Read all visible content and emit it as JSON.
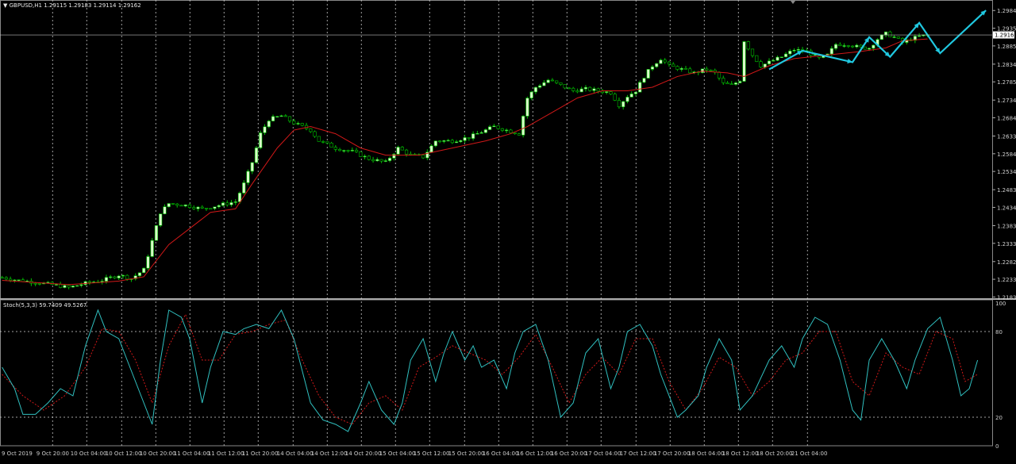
{
  "header": {
    "symbol": "GBPUSD,H1",
    "ohlc": "1.29115 1.29183 1.29114 1.29162"
  },
  "current_price": "1.29162",
  "stoch_header": "Stoch(5,3,3) 59.7409 49.5267",
  "price_axis_labels": [
    "1.29845",
    "1.29350",
    "1.28855",
    "1.28345",
    "1.27850",
    "1.27340",
    "1.26845",
    "1.26335",
    "1.25840",
    "1.25345",
    "1.24835",
    "1.24340",
    "1.23830",
    "1.23335",
    "1.22825",
    "1.22330",
    "1.21835"
  ],
  "stoch_axis_labels": [
    "100",
    "80",
    "20",
    "0"
  ],
  "time_labels": [
    "9 Oct 2019",
    "9 Oct 20:00",
    "10 Oct 04:00",
    "10 Oct 12:00",
    "10 Oct 20:00",
    "11 Oct 04:00",
    "11 Oct 12:00",
    "11 Oct 20:00",
    "14 Oct 04:00",
    "14 Oct 12:00",
    "14 Oct 20:00",
    "15 Oct 04:00",
    "15 Oct 12:00",
    "15 Oct 20:00",
    "16 Oct 04:00",
    "16 Oct 12:00",
    "16 Oct 20:00",
    "17 Oct 04:00",
    "17 Oct 12:00",
    "17 Oct 20:00",
    "18 Oct 04:00",
    "18 Oct 12:00",
    "18 Oct 20:00",
    "21 Oct 04:00"
  ],
  "colors": {
    "background": "#000000",
    "bull_candle": "#d8ffc8",
    "bear_candle": "#000000",
    "wick": "#00c000",
    "ma_line": "#d01818",
    "stoch_main": "#30c0c0",
    "stoch_signal": "#d01818",
    "arrows": "#20c8e0",
    "grid": "#c8c8c8"
  },
  "chart_data": [
    {
      "type": "candlestick",
      "title": "GBPUSD,H1",
      "ylim": [
        1.218,
        1.3005
      ],
      "grid": true,
      "close_path": [
        [
          0,
          1.2238
        ],
        [
          4,
          1.223
        ],
        [
          8,
          1.2225
        ],
        [
          12,
          1.2218
        ],
        [
          16,
          1.221
        ],
        [
          20,
          1.2222
        ],
        [
          24,
          1.223
        ],
        [
          28,
          1.2245
        ],
        [
          31,
          1.2235
        ],
        [
          34,
          1.226
        ],
        [
          36,
          1.234
        ],
        [
          38,
          1.242
        ],
        [
          40,
          1.2445
        ],
        [
          44,
          1.244
        ],
        [
          48,
          1.243
        ],
        [
          52,
          1.244
        ],
        [
          56,
          1.245
        ],
        [
          58,
          1.25
        ],
        [
          60,
          1.256
        ],
        [
          62,
          1.264
        ],
        [
          64,
          1.268
        ],
        [
          67,
          1.269
        ],
        [
          70,
          1.267
        ],
        [
          74,
          1.265
        ],
        [
          76,
          1.262
        ],
        [
          80,
          1.26
        ],
        [
          84,
          1.259
        ],
        [
          88,
          1.257
        ],
        [
          92,
          1.256
        ],
        [
          95,
          1.26
        ],
        [
          98,
          1.258
        ],
        [
          101,
          1.2575
        ],
        [
          104,
          1.262
        ],
        [
          108,
          1.262
        ],
        [
          112,
          1.263
        ],
        [
          115,
          1.2645
        ],
        [
          118,
          1.266
        ],
        [
          121,
          1.265
        ],
        [
          124,
          1.264
        ],
        [
          126,
          1.274
        ],
        [
          128,
          1.277
        ],
        [
          131,
          1.279
        ],
        [
          134,
          1.2775
        ],
        [
          137,
          1.276
        ],
        [
          140,
          1.2765
        ],
        [
          143,
          1.276
        ],
        [
          146,
          1.2755
        ],
        [
          148,
          1.272
        ],
        [
          150,
          1.2745
        ],
        [
          152,
          1.276
        ],
        [
          154,
          1.28
        ],
        [
          156,
          1.283
        ],
        [
          158,
          1.285
        ],
        [
          160,
          1.283
        ],
        [
          163,
          1.282
        ],
        [
          166,
          1.281
        ],
        [
          169,
          1.282
        ],
        [
          171,
          1.281
        ],
        [
          173,
          1.278
        ],
        [
          175,
          1.2775
        ],
        [
          177,
          1.279
        ],
        [
          178,
          1.29
        ],
        [
          180,
          1.286
        ],
        [
          182,
          1.283
        ],
        [
          184,
          1.284
        ],
        [
          187,
          1.2855
        ],
        [
          190,
          1.2875
        ],
        [
          193,
          1.287
        ],
        [
          196,
          1.285
        ],
        [
          198,
          1.286
        ],
        [
          200,
          1.289
        ],
        [
          203,
          1.289
        ],
        [
          206,
          1.288
        ],
        [
          208,
          1.288
        ],
        [
          210,
          1.2905
        ],
        [
          212,
          1.292
        ],
        [
          214,
          1.291
        ],
        [
          216,
          1.2895
        ],
        [
          218,
          1.2905
        ],
        [
          220,
          1.2912
        ],
        [
          222,
          1.2916
        ]
      ],
      "ma_path": [
        [
          0,
          1.223
        ],
        [
          16,
          1.2218
        ],
        [
          28,
          1.2228
        ],
        [
          34,
          1.224
        ],
        [
          40,
          1.233
        ],
        [
          50,
          1.242
        ],
        [
          56,
          1.243
        ],
        [
          60,
          1.25
        ],
        [
          66,
          1.26
        ],
        [
          70,
          1.265
        ],
        [
          74,
          1.266
        ],
        [
          80,
          1.264
        ],
        [
          86,
          1.26
        ],
        [
          92,
          1.258
        ],
        [
          100,
          1.258
        ],
        [
          108,
          1.26
        ],
        [
          116,
          1.262
        ],
        [
          122,
          1.264
        ],
        [
          126,
          1.266
        ],
        [
          132,
          1.27
        ],
        [
          138,
          1.274
        ],
        [
          144,
          1.276
        ],
        [
          150,
          1.276
        ],
        [
          156,
          1.277
        ],
        [
          162,
          1.28
        ],
        [
          168,
          1.2815
        ],
        [
          174,
          1.281
        ],
        [
          178,
          1.28
        ],
        [
          184,
          1.283
        ],
        [
          190,
          1.285
        ],
        [
          198,
          1.286
        ],
        [
          206,
          1.287
        ],
        [
          212,
          1.288
        ],
        [
          216,
          1.29
        ],
        [
          222,
          1.2905
        ]
      ],
      "arrows_path": [
        [
          184,
          1.282
        ],
        [
          192,
          1.2872
        ],
        [
          204,
          1.284
        ],
        [
          208,
          1.291
        ],
        [
          213,
          1.2855
        ],
        [
          220,
          1.295
        ],
        [
          225,
          1.2865
        ],
        [
          236,
          1.2985
        ]
      ]
    },
    {
      "type": "line",
      "title": "Stoch(5,3,3) 59.7409 49.5267",
      "ylim": [
        0,
        100
      ],
      "main_path": [
        [
          0,
          55
        ],
        [
          3,
          40
        ],
        [
          5,
          22
        ],
        [
          8,
          22
        ],
        [
          11,
          30
        ],
        [
          14,
          40
        ],
        [
          17,
          35
        ],
        [
          20,
          70
        ],
        [
          23,
          95
        ],
        [
          25,
          80
        ],
        [
          28,
          75
        ],
        [
          30,
          60
        ],
        [
          34,
          30
        ],
        [
          36,
          15
        ],
        [
          38,
          60
        ],
        [
          40,
          95
        ],
        [
          43,
          90
        ],
        [
          45,
          75
        ],
        [
          48,
          30
        ],
        [
          50,
          55
        ],
        [
          53,
          80
        ],
        [
          56,
          78
        ],
        [
          58,
          82
        ],
        [
          61,
          85
        ],
        [
          64,
          82
        ],
        [
          67,
          95
        ],
        [
          70,
          75
        ],
        [
          74,
          30
        ],
        [
          77,
          18
        ],
        [
          80,
          15
        ],
        [
          83,
          10
        ],
        [
          86,
          30
        ],
        [
          88,
          45
        ],
        [
          91,
          25
        ],
        [
          94,
          15
        ],
        [
          96,
          30
        ],
        [
          98,
          60
        ],
        [
          101,
          75
        ],
        [
          104,
          45
        ],
        [
          106,
          65
        ],
        [
          108,
          80
        ],
        [
          111,
          60
        ],
        [
          113,
          70
        ],
        [
          115,
          55
        ],
        [
          118,
          60
        ],
        [
          121,
          40
        ],
        [
          123,
          65
        ],
        [
          125,
          80
        ],
        [
          128,
          85
        ],
        [
          131,
          60
        ],
        [
          134,
          20
        ],
        [
          137,
          30
        ],
        [
          140,
          65
        ],
        [
          143,
          75
        ],
        [
          146,
          40
        ],
        [
          148,
          55
        ],
        [
          150,
          80
        ],
        [
          153,
          85
        ],
        [
          156,
          70
        ],
        [
          158,
          50
        ],
        [
          162,
          20
        ],
        [
          164,
          25
        ],
        [
          167,
          35
        ],
        [
          169,
          55
        ],
        [
          172,
          75
        ],
        [
          175,
          60
        ],
        [
          177,
          25
        ],
        [
          180,
          35
        ],
        [
          184,
          60
        ],
        [
          187,
          70
        ],
        [
          190,
          55
        ],
        [
          192,
          75
        ],
        [
          195,
          90
        ],
        [
          198,
          85
        ],
        [
          201,
          60
        ],
        [
          204,
          25
        ],
        [
          206,
          18
        ],
        [
          208,
          60
        ],
        [
          211,
          75
        ],
        [
          214,
          60
        ],
        [
          217,
          40
        ],
        [
          219,
          60
        ],
        [
          222,
          82
        ],
        [
          225,
          90
        ],
        [
          228,
          60
        ],
        [
          230,
          35
        ],
        [
          232,
          40
        ],
        [
          234,
          60
        ]
      ],
      "signal_path": [
        [
          0,
          50
        ],
        [
          5,
          35
        ],
        [
          10,
          25
        ],
        [
          15,
          35
        ],
        [
          20,
          55
        ],
        [
          24,
          82
        ],
        [
          28,
          80
        ],
        [
          32,
          60
        ],
        [
          36,
          30
        ],
        [
          40,
          70
        ],
        [
          44,
          92
        ],
        [
          48,
          60
        ],
        [
          52,
          60
        ],
        [
          56,
          78
        ],
        [
          60,
          80
        ],
        [
          64,
          85
        ],
        [
          68,
          88
        ],
        [
          72,
          60
        ],
        [
          76,
          35
        ],
        [
          80,
          20
        ],
        [
          84,
          15
        ],
        [
          88,
          30
        ],
        [
          92,
          35
        ],
        [
          96,
          25
        ],
        [
          100,
          55
        ],
        [
          104,
          62
        ],
        [
          108,
          70
        ],
        [
          112,
          65
        ],
        [
          116,
          60
        ],
        [
          120,
          50
        ],
        [
          124,
          62
        ],
        [
          128,
          78
        ],
        [
          132,
          55
        ],
        [
          136,
          30
        ],
        [
          140,
          50
        ],
        [
          144,
          62
        ],
        [
          148,
          50
        ],
        [
          152,
          75
        ],
        [
          156,
          75
        ],
        [
          160,
          45
        ],
        [
          164,
          25
        ],
        [
          168,
          40
        ],
        [
          172,
          62
        ],
        [
          176,
          55
        ],
        [
          180,
          35
        ],
        [
          184,
          45
        ],
        [
          188,
          60
        ],
        [
          192,
          65
        ],
        [
          196,
          80
        ],
        [
          200,
          80
        ],
        [
          204,
          45
        ],
        [
          208,
          35
        ],
        [
          212,
          65
        ],
        [
          216,
          55
        ],
        [
          220,
          50
        ],
        [
          224,
          80
        ],
        [
          228,
          75
        ],
        [
          231,
          45
        ],
        [
          234,
          50
        ]
      ]
    }
  ]
}
